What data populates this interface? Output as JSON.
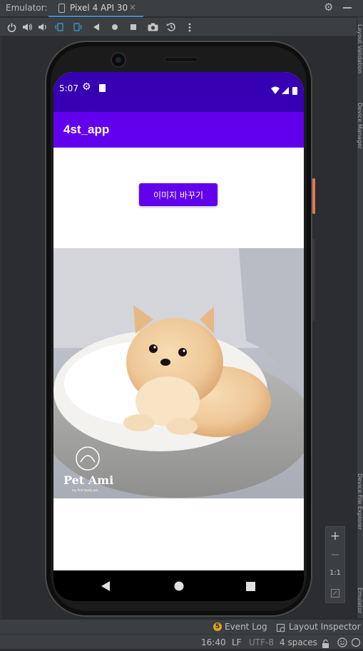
{
  "ide": {
    "emulator_label": "Emulator:",
    "device_tab": "Pixel 4 API 30",
    "tab_close": "×",
    "right_panels": [
      "Layout Validation",
      "Device Manager",
      "Device File Explorer",
      "Emulator"
    ]
  },
  "toolbar": {
    "icons": [
      "power-icon",
      "volume-up-icon",
      "volume-down-icon",
      "rotate-left-icon",
      "rotate-right-icon",
      "back-icon",
      "home-icon",
      "overview-icon",
      "camera-icon",
      "snapshot-icon",
      "more-icon"
    ]
  },
  "device": {
    "status_time": "5:07",
    "app_title": "4st_app",
    "button_label": "이미지 바꾸기",
    "photo_brand": "Pet Ami",
    "photo_tagline": "my first lovely pet"
  },
  "zoom": {
    "plus": "+",
    "minus": "−",
    "ratio": "1:1"
  },
  "statusbar": {
    "event_log": "Event Log",
    "event_badge": "5",
    "layout_inspector": "Layout Inspector",
    "time": "16:40",
    "line_ending": "LF",
    "encoding": "UTF-8",
    "indent": "4 spaces"
  },
  "colors": {
    "status_bar": "#3700b3",
    "app_bar": "#6200ee",
    "button": "#6200ee"
  }
}
